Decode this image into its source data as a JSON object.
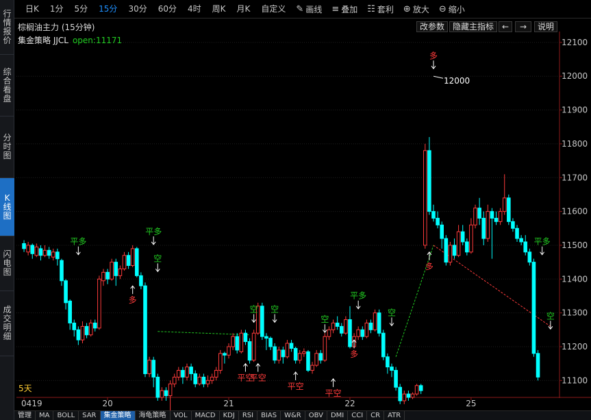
{
  "sidebar": {
    "tabs": [
      {
        "label": "行情报价",
        "active": false
      },
      {
        "label": "综合看盘",
        "active": false
      },
      {
        "label": "分时图",
        "active": false
      },
      {
        "label": "K线图",
        "active": true
      },
      {
        "label": "闪电图",
        "active": false
      },
      {
        "label": "成交明细",
        "active": false
      }
    ]
  },
  "toolbar": {
    "timeframes": [
      {
        "label": "日K",
        "active": false
      },
      {
        "label": "1分",
        "active": false
      },
      {
        "label": "5分",
        "active": false
      },
      {
        "label": "15分",
        "active": true
      },
      {
        "label": "30分",
        "active": false
      },
      {
        "label": "60分",
        "active": false
      },
      {
        "label": "4时",
        "active": false
      },
      {
        "label": "周K",
        "active": false
      },
      {
        "label": "月K",
        "active": false
      },
      {
        "label": "自定义",
        "active": false
      }
    ],
    "tools": [
      {
        "label": "画线",
        "icon": "pencil-icon"
      },
      {
        "label": "叠加",
        "icon": "stack-icon"
      },
      {
        "label": "套利",
        "icon": "sliders-icon"
      },
      {
        "label": "放大",
        "icon": "zoom-in-icon"
      },
      {
        "label": "缩小",
        "icon": "zoom-out-icon"
      }
    ]
  },
  "header": {
    "symbol": "棕榈油主力 (15分钟)",
    "buttons": {
      "params": "改参数",
      "hide": "隐藏主指标",
      "prev": "←",
      "next": "→",
      "help": "说明"
    }
  },
  "strategy": {
    "name": "集金策略 JJCL",
    "open": "open:11171"
  },
  "period_label": "5天",
  "bottom_tabs": [
    {
      "label": "管理",
      "active": false
    },
    {
      "label": "MA",
      "active": false
    },
    {
      "label": "BOLL",
      "active": false
    },
    {
      "label": "SAR",
      "active": false
    },
    {
      "label": "集金策略",
      "active": true
    },
    {
      "label": "海龟策略",
      "active": false
    },
    {
      "label": "VOL",
      "active": false
    },
    {
      "label": "MACD",
      "active": false
    },
    {
      "label": "KDJ",
      "active": false
    },
    {
      "label": "RSI",
      "active": false
    },
    {
      "label": "BIAS",
      "active": false
    },
    {
      "label": "W&R",
      "active": false
    },
    {
      "label": "OBV",
      "active": false
    },
    {
      "label": "DMI",
      "active": false
    },
    {
      "label": "CCI",
      "active": false
    },
    {
      "label": "CR",
      "active": false
    },
    {
      "label": "ATR",
      "active": false
    }
  ],
  "colors": {
    "up": "#ff3b3b",
    "down": "#00ffff",
    "signal_short": "#22cc22",
    "signal_long": "#ff3b3b",
    "axis": "#8b1a1a",
    "active_tab": "#1e6fc4"
  },
  "chart_data": {
    "type": "candlestick",
    "title": "棕榈油主力 (15分钟)",
    "ylim": [
      11050,
      12120
    ],
    "y_ticks": [
      11100,
      11200,
      11300,
      11400,
      11500,
      11600,
      11700,
      11800,
      11900,
      12000,
      12100
    ],
    "x_tick_labels": [
      {
        "label": "0419",
        "index": 0
      },
      {
        "label": "20",
        "index": 20
      },
      {
        "label": "21",
        "index": 49
      },
      {
        "label": "22",
        "index": 78
      },
      {
        "label": "25",
        "index": 107
      }
    ],
    "bar_count": 128,
    "highs_lows": [
      {
        "label": "12000",
        "value": 12000,
        "index": 98
      },
      {
        "label": "11000",
        "value": 11000,
        "index": 35
      }
    ],
    "bars": [
      [
        11505,
        11490,
        11515,
        11480
      ],
      [
        11480,
        11500,
        11510,
        11470
      ],
      [
        11500,
        11475,
        11505,
        11460
      ],
      [
        11470,
        11495,
        11505,
        11465
      ],
      [
        11490,
        11470,
        11500,
        11455
      ],
      [
        11470,
        11485,
        11500,
        11465
      ],
      [
        11485,
        11470,
        11495,
        11460
      ],
      [
        11465,
        11480,
        11490,
        11455
      ],
      [
        11480,
        11460,
        11490,
        11440
      ],
      [
        11455,
        11395,
        11460,
        11380
      ],
      [
        11395,
        11330,
        11400,
        11310
      ],
      [
        11335,
        11270,
        11340,
        11250
      ],
      [
        11270,
        11250,
        11280,
        11230
      ],
      [
        11250,
        11220,
        11260,
        11205
      ],
      [
        11220,
        11260,
        11275,
        11210
      ],
      [
        11260,
        11235,
        11270,
        11225
      ],
      [
        11235,
        11270,
        11280,
        11230
      ],
      [
        11270,
        11255,
        11280,
        11245
      ],
      [
        11255,
        11400,
        11410,
        11250
      ],
      [
        11395,
        11420,
        11430,
        11380
      ],
      [
        11420,
        11400,
        11430,
        11385
      ],
      [
        11400,
        11450,
        11460,
        11395
      ],
      [
        11450,
        11410,
        11460,
        11380
      ],
      [
        11410,
        11430,
        11440,
        11400
      ],
      [
        11430,
        11470,
        11480,
        11425
      ],
      [
        11470,
        11440,
        11480,
        11430
      ],
      [
        11440,
        11490,
        11500,
        11435
      ],
      [
        11490,
        11410,
        11495,
        11405
      ],
      [
        11410,
        11380,
        11420,
        11370
      ],
      [
        11380,
        11120,
        11390,
        11110
      ],
      [
        11120,
        11160,
        11170,
        11110
      ],
      [
        11160,
        11110,
        11170,
        11080
      ],
      [
        11110,
        11050,
        11120,
        11040
      ],
      [
        11050,
        11070,
        11080,
        11040
      ],
      [
        11070,
        11055,
        11080,
        11040
      ],
      [
        11055,
        11090,
        11100,
        11000
      ],
      [
        11090,
        11110,
        11120,
        11080
      ],
      [
        11110,
        11130,
        11140,
        11100
      ],
      [
        11130,
        11110,
        11140,
        11090
      ],
      [
        11110,
        11140,
        11150,
        11100
      ],
      [
        11140,
        11120,
        11150,
        11100
      ],
      [
        11120,
        11090,
        11130,
        11080
      ],
      [
        11090,
        11110,
        11120,
        11085
      ],
      [
        11110,
        11090,
        11120,
        11080
      ],
      [
        11090,
        11100,
        11115,
        11080
      ],
      [
        11100,
        11110,
        11120,
        11090
      ],
      [
        11110,
        11130,
        11140,
        11100
      ],
      [
        11130,
        11180,
        11190,
        11120
      ],
      [
        11180,
        11175,
        11185,
        11150
      ],
      [
        11175,
        11200,
        11210,
        11165
      ],
      [
        11200,
        11230,
        11240,
        11190
      ],
      [
        11230,
        11190,
        11240,
        11180
      ],
      [
        11185,
        11240,
        11250,
        11180
      ],
      [
        11240,
        11215,
        11250,
        11205
      ],
      [
        11215,
        11160,
        11225,
        11150
      ],
      [
        11160,
        11240,
        11250,
        11155
      ],
      [
        11240,
        11320,
        11330,
        11235
      ],
      [
        11320,
        11230,
        11330,
        11220
      ],
      [
        11230,
        11225,
        11240,
        11190
      ],
      [
        11225,
        11200,
        11230,
        11190
      ],
      [
        11200,
        11160,
        11210,
        11150
      ],
      [
        11160,
        11190,
        11200,
        11150
      ],
      [
        11190,
        11170,
        11200,
        11150
      ],
      [
        11170,
        11210,
        11220,
        11165
      ],
      [
        11210,
        11195,
        11220,
        11185
      ],
      [
        11195,
        11160,
        11200,
        11150
      ],
      [
        11160,
        11180,
        11190,
        11150
      ],
      [
        11180,
        11185,
        11195,
        11170
      ],
      [
        11185,
        11130,
        11190,
        11125
      ],
      [
        11130,
        11145,
        11155,
        11120
      ],
      [
        11145,
        11180,
        11190,
        11140
      ],
      [
        11180,
        11160,
        11190,
        11150
      ],
      [
        11160,
        11230,
        11240,
        11155
      ],
      [
        11230,
        11250,
        11260,
        11220
      ],
      [
        11250,
        11270,
        11280,
        11240
      ],
      [
        11270,
        11260,
        11290,
        11250
      ],
      [
        11260,
        11240,
        11270,
        11230
      ],
      [
        11240,
        11280,
        11290,
        11235
      ],
      [
        11280,
        11200,
        11320,
        11195
      ],
      [
        11200,
        11230,
        11240,
        11195
      ],
      [
        11230,
        11250,
        11260,
        11220
      ],
      [
        11250,
        11230,
        11260,
        11220
      ],
      [
        11230,
        11270,
        11280,
        11225
      ],
      [
        11270,
        11250,
        11280,
        11240
      ],
      [
        11250,
        11300,
        11310,
        11245
      ],
      [
        11300,
        11240,
        11310,
        11230
      ],
      [
        11240,
        11170,
        11250,
        11160
      ],
      [
        11170,
        11140,
        11180,
        11120
      ],
      [
        11140,
        11130,
        11150,
        11110
      ],
      [
        11130,
        11080,
        11140,
        11070
      ],
      [
        11080,
        11040,
        11090,
        11030
      ],
      [
        11040,
        11060,
        11070,
        11030
      ],
      [
        11060,
        11050,
        11070,
        11040
      ],
      [
        11050,
        11060,
        11065,
        11045
      ],
      [
        11060,
        11085,
        11090,
        11055
      ],
      [
        11085,
        11070,
        11090,
        11060
      ],
      [
        11500,
        11780,
        11800,
        11490
      ],
      [
        11780,
        11600,
        11820,
        11590
      ],
      [
        11600,
        11580,
        11620,
        11570
      ],
      [
        11580,
        11560,
        11600,
        11550
      ],
      [
        11560,
        11520,
        11570,
        11490
      ],
      [
        11520,
        11450,
        11530,
        11440
      ],
      [
        11450,
        11500,
        11510,
        11440
      ],
      [
        11500,
        11470,
        11520,
        11460
      ],
      [
        11470,
        11540,
        11560,
        11465
      ],
      [
        11540,
        11510,
        11560,
        11500
      ],
      [
        11510,
        11480,
        11520,
        11470
      ],
      [
        11480,
        11560,
        11580,
        11475
      ],
      [
        11560,
        11610,
        11620,
        11550
      ],
      [
        11610,
        11580,
        11640,
        11560
      ],
      [
        11580,
        11520,
        11600,
        11500
      ],
      [
        11520,
        11600,
        11620,
        11510
      ],
      [
        11600,
        11580,
        11610,
        11460
      ],
      [
        11580,
        11570,
        11600,
        11560
      ],
      [
        11570,
        11600,
        11610,
        11560
      ],
      [
        11600,
        11640,
        11710,
        11590
      ],
      [
        11640,
        11570,
        11650,
        11560
      ],
      [
        11570,
        11550,
        11580,
        11540
      ],
      [
        11550,
        11520,
        11560,
        11510
      ],
      [
        11520,
        11510,
        11530,
        11500
      ],
      [
        11510,
        11480,
        11530,
        11470
      ],
      [
        11480,
        11450,
        11490,
        11440
      ],
      [
        11450,
        11180,
        11460,
        11170
      ],
      [
        11180,
        11110,
        11190,
        11100
      ]
    ],
    "signals": [
      {
        "label": "平多",
        "index": 13,
        "value": 11470,
        "type": "short",
        "pos": "above"
      },
      {
        "label": "多",
        "index": 26,
        "value": 11380,
        "type": "long",
        "pos": "below"
      },
      {
        "label": "平多",
        "index": 31,
        "value": 11500,
        "type": "short",
        "pos": "above"
      },
      {
        "label": "空",
        "index": 32,
        "value": 11420,
        "type": "short",
        "pos": "above"
      },
      {
        "label": "平空",
        "index": 53,
        "value": 11150,
        "type": "long",
        "pos": "below"
      },
      {
        "label": "平空",
        "index": 56,
        "value": 11150,
        "type": "long",
        "pos": "below"
      },
      {
        "label": "空",
        "index": 55,
        "value": 11270,
        "type": "short",
        "pos": "above"
      },
      {
        "label": "空",
        "index": 60,
        "value": 11270,
        "type": "short",
        "pos": "above"
      },
      {
        "label": "平空",
        "index": 65,
        "value": 11125,
        "type": "long",
        "pos": "below"
      },
      {
        "label": "空",
        "index": 72,
        "value": 11240,
        "type": "short",
        "pos": "above"
      },
      {
        "label": "平空",
        "index": 74,
        "value": 11105,
        "type": "long",
        "pos": "below"
      },
      {
        "label": "多",
        "index": 79,
        "value": 11220,
        "type": "long",
        "pos": "below"
      },
      {
        "label": "平多",
        "index": 80,
        "value": 11310,
        "type": "short",
        "pos": "above"
      },
      {
        "label": "空",
        "index": 88,
        "value": 11260,
        "type": "short",
        "pos": "above"
      },
      {
        "label": "多",
        "index": 97,
        "value": 11480,
        "type": "long",
        "pos": "below"
      },
      {
        "label": "多",
        "index": 98,
        "value": 12020,
        "type": "long",
        "pos": "above_top"
      },
      {
        "label": "平多",
        "index": 124,
        "value": 11470,
        "type": "short",
        "pos": "above"
      },
      {
        "label": "空",
        "index": 126,
        "value": 11250,
        "type": "short",
        "pos": "above"
      }
    ],
    "trades": [
      {
        "from": [
          32,
          11245
        ],
        "to": [
          54,
          11235
        ],
        "color": "#22cc22"
      },
      {
        "from": [
          89,
          11170
        ],
        "to": [
          98,
          11500
        ],
        "color": "#22cc22"
      },
      {
        "from": [
          98,
          11500
        ],
        "to": [
          126,
          11260
        ],
        "color": "#ff3b3b"
      }
    ]
  }
}
